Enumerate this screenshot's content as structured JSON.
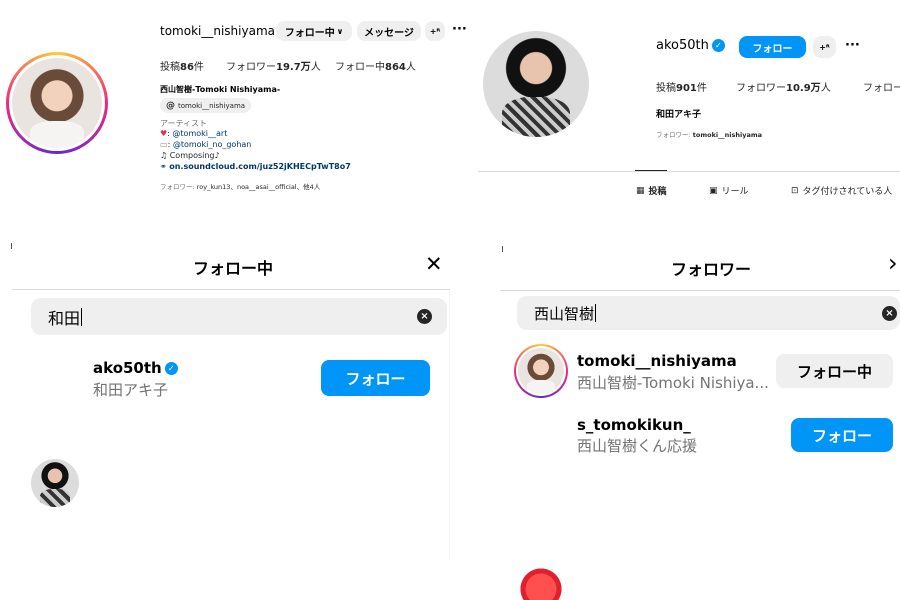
{
  "tl": {
    "username": "tomoki__nishiyama",
    "following_button": "フォロー中",
    "message_button": "メッセージ",
    "more": "···",
    "stats": {
      "posts_label": "投稿",
      "posts": "86",
      "posts_unit": "件",
      "followers_label": "フォロワー",
      "followers": "19.7万",
      "followers_unit": "人",
      "following_label": "フォロー中",
      "following": "864",
      "following_unit": "人"
    },
    "full_name": "西山智樹-Tomoki Nishiyama-",
    "threads_handle": "tomoki__nishiyama",
    "bio_lines": [
      "アーティスト",
      "@tomoki__art",
      "@tomoki_no_gohan",
      "Composing♪"
    ],
    "bio_prefix_1": ": ",
    "bio_prefix_2": ": ",
    "bio_prefix_3": " ",
    "link": "on.soundcloud.com/juz52jKHECpTwT8o7",
    "followed_by_label": "フォロワー: ",
    "followed_by": "roy_kun13、noa__asai__official、他4人"
  },
  "tr": {
    "username": "ako50th",
    "follow_button": "フォロー",
    "more": "···",
    "stats": {
      "posts_label": "投稿",
      "posts": "901",
      "posts_unit": "件",
      "followers_label": "フォロワー",
      "followers": "10.9万",
      "followers_unit": "人",
      "following_label": "フォロー"
    },
    "full_name": "和田アキ子",
    "followed_by_label": "フォロワー: ",
    "followed_by": "tomoki__nishiyama",
    "tabs": [
      "投稿",
      "リール",
      "タグ付けされている人"
    ]
  },
  "bl": {
    "title": "フォロー中",
    "close": "✕",
    "search_value": "和田",
    "result": {
      "username": "ako50th",
      "full_name": "和田アキ子",
      "button": "フォロー"
    }
  },
  "br": {
    "title": "フォロワー",
    "close": "›",
    "search_value": "西山智樹",
    "results": [
      {
        "username": "tomoki__nishiyama",
        "full_name": "西山智樹-Tomoki Nishiya...",
        "button": "フォロー中"
      },
      {
        "username": "s_tomokikun_",
        "full_name": "西山智樹くん応援",
        "button": "フォロー"
      }
    ]
  },
  "colors": {
    "accent": "#0095f6",
    "gray_button": "#efefef",
    "divider": "#dbdbdb"
  }
}
